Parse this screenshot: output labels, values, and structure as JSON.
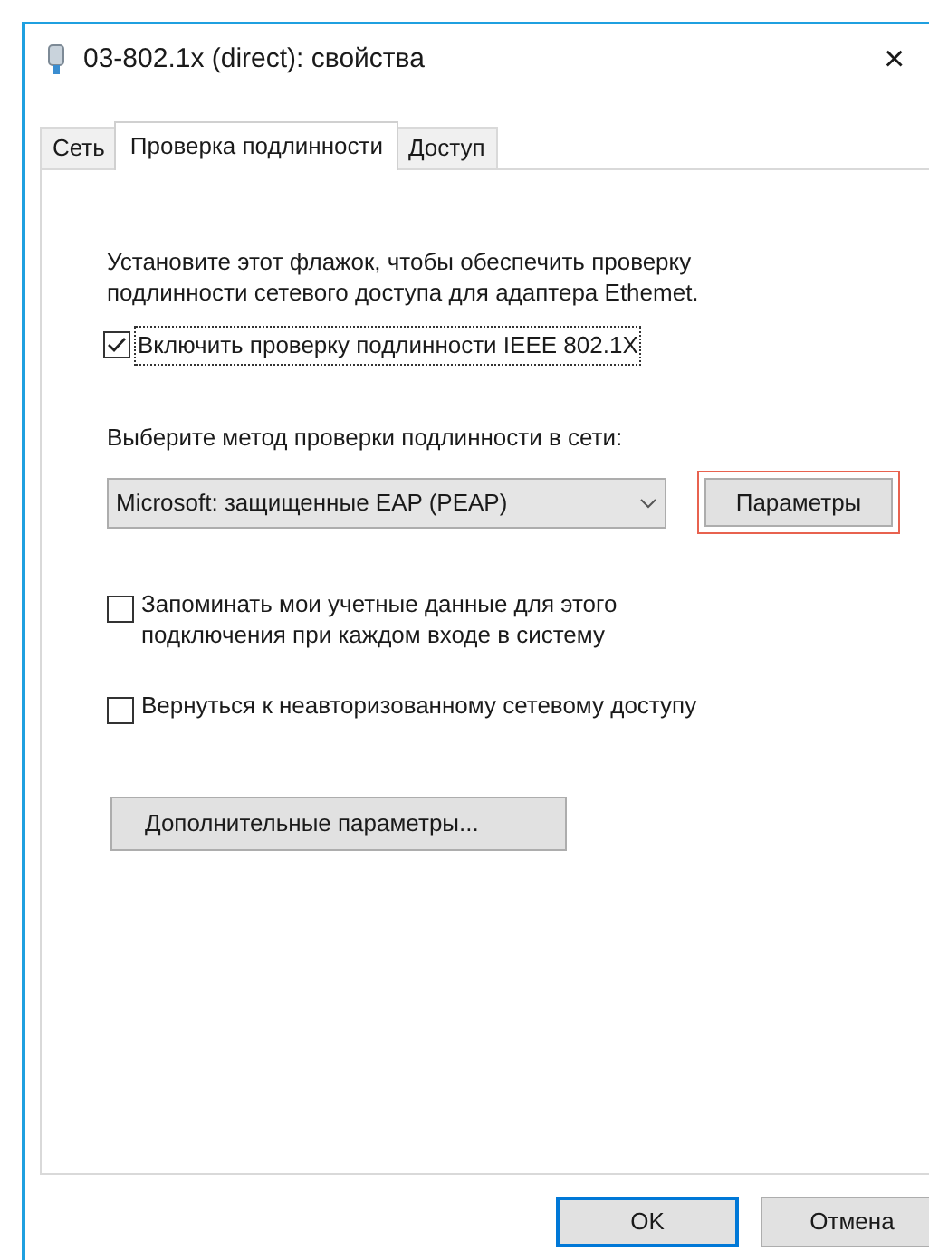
{
  "window": {
    "title": "03-802.1x (direct): свойства",
    "close": "×"
  },
  "tabs": [
    {
      "label": "Сеть",
      "selected": false
    },
    {
      "label": "Проверка подлинности",
      "selected": true
    },
    {
      "label": "Доступ",
      "selected": false
    }
  ],
  "description": "Установите этот флажок, чтобы обеспечить проверку подлинности сетевого доступа для адаптера Ethemet.",
  "enable_checkbox": {
    "label": "Включить проверку подлинности IEEE 802.1X",
    "checked": true,
    "focused": true
  },
  "method_label": "Выберите метод проверки подлинности в сети:",
  "method_select": {
    "value": "Microsoft: защищенные EAP (PEAP)"
  },
  "settings_button": {
    "label": "Параметры",
    "highlighted": true
  },
  "options": [
    {
      "label": "Запоминать мои учетные данные для этого подключения при каждом входе в систему",
      "checked": false
    },
    {
      "label": "Вернуться к неавторизованному сетевому доступу",
      "checked": false
    }
  ],
  "advanced_button": {
    "label": "Дополнительные параметры..."
  },
  "buttons": [
    {
      "label": "OK",
      "default": true
    },
    {
      "label": "Отмена",
      "default": false
    }
  ]
}
